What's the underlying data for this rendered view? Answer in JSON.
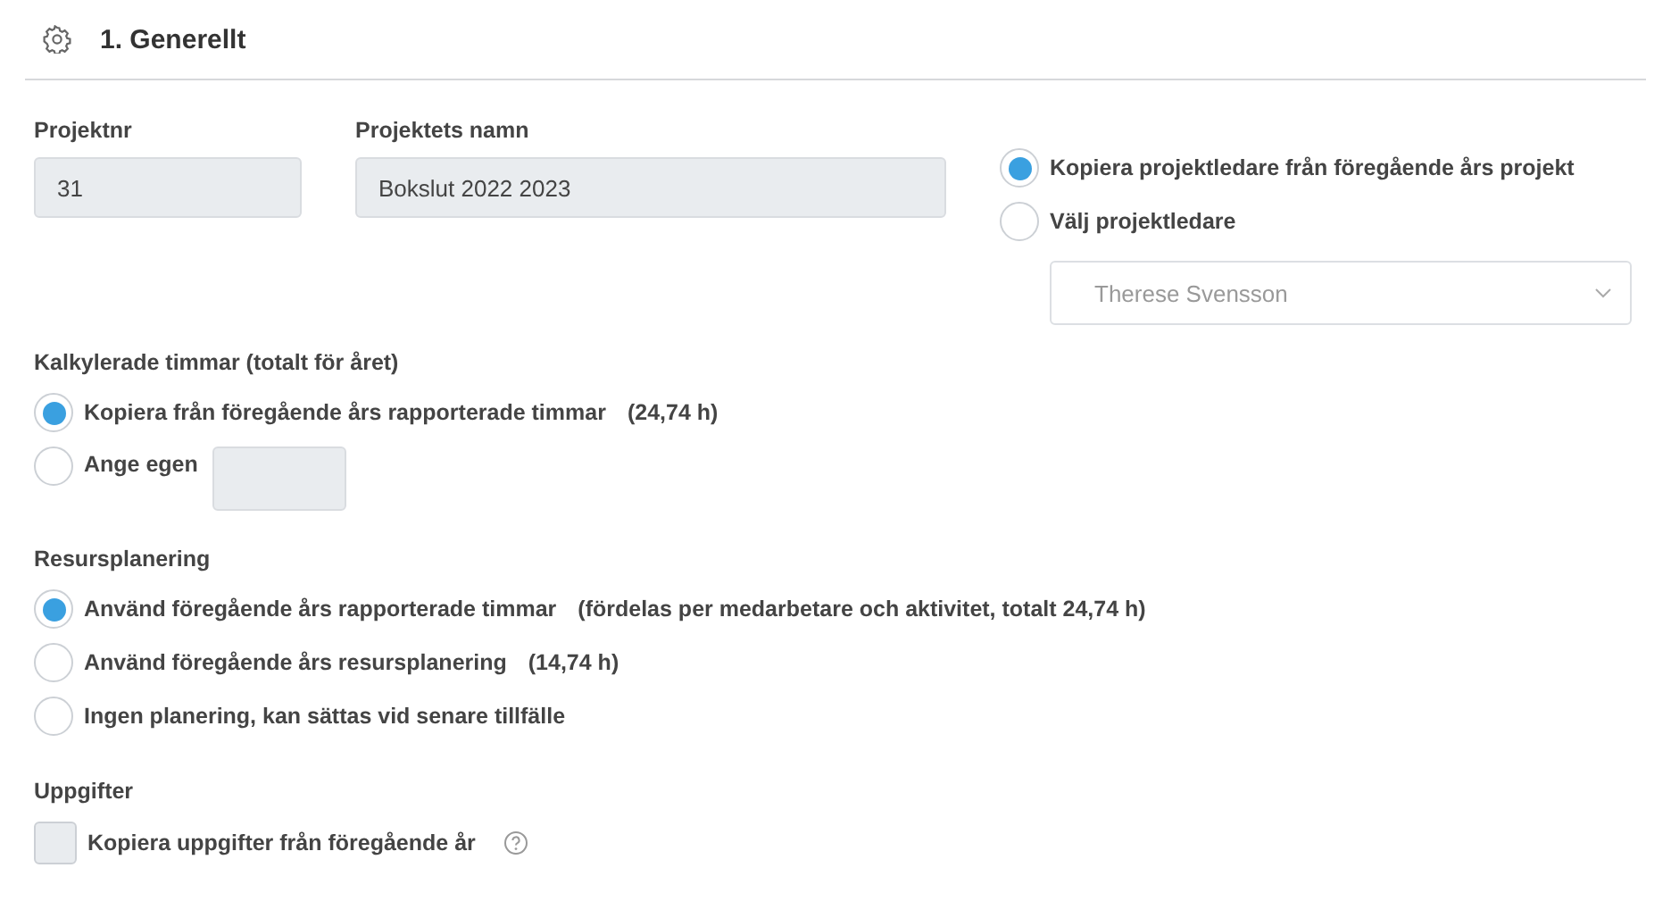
{
  "section": {
    "title": "1. Generellt"
  },
  "fields": [
    {
      "label": "Projektnr",
      "value": "31",
      "kind": "short"
    },
    {
      "label": "Projektets namn",
      "value": "Bokslut 2022 2023",
      "kind": "long"
    }
  ],
  "project_leader": {
    "options": [
      {
        "label": "Kopiera projektledare från föregående års projekt",
        "selected": true
      },
      {
        "label": "Välj projektledare",
        "selected": false
      }
    ],
    "dropdown": {
      "value": "Therese Svensson"
    }
  },
  "groups": [
    {
      "title": "Kalkylerade timmar (totalt för året)",
      "options": [
        {
          "label": "Kopiera från föregående års rapporterade timmar",
          "note": "(24,74 h)",
          "selected": true,
          "kind": "plain"
        },
        {
          "label": "Ange egen",
          "selected": false,
          "kind": "with_field"
        }
      ]
    },
    {
      "title": "Resursplanering",
      "options": [
        {
          "label": "Använd föregående års rapporterade timmar",
          "note": "(fördelas per medarbetare och aktivitet, totalt 24,74 h)",
          "selected": true,
          "kind": "plain"
        },
        {
          "label": "Använd föregående års resursplanering",
          "note": "(14,74 h)",
          "selected": false,
          "kind": "plain"
        },
        {
          "label": "Ingen planering, kan sättas vid senare tillfälle",
          "selected": false,
          "kind": "plain"
        }
      ]
    }
  ],
  "tasks": {
    "title": "Uppgifter",
    "checkbox": {
      "label": "Kopiera uppgifter från föregående år",
      "checked": false
    }
  }
}
